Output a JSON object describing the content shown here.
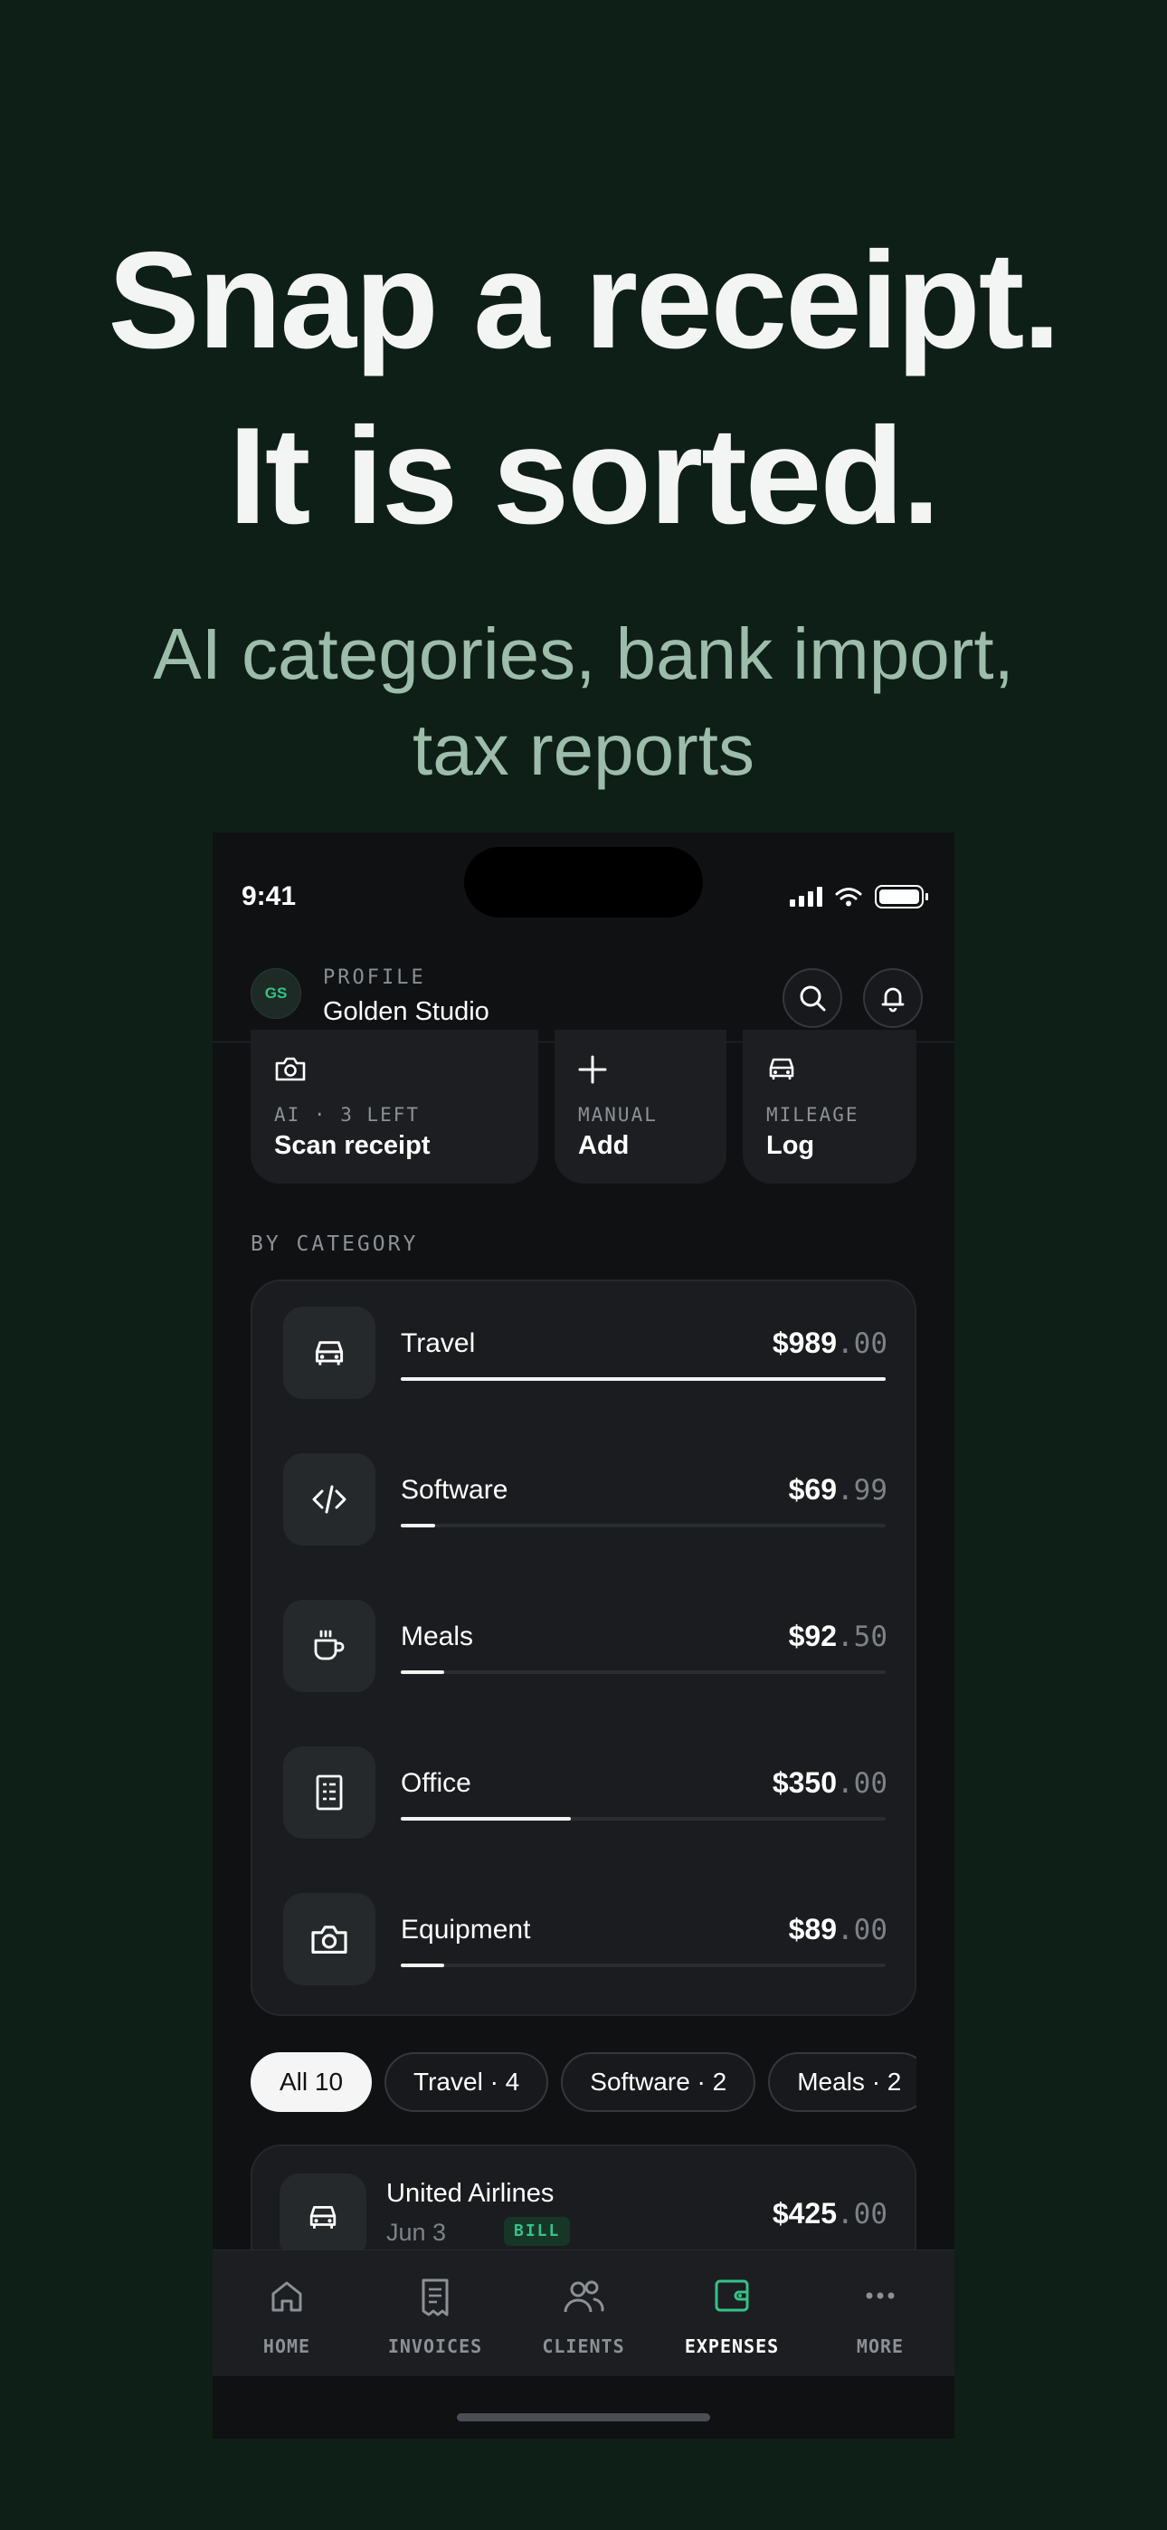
{
  "hero": {
    "title_line1": "Snap a receipt.",
    "title_line2": "It is sorted.",
    "subtitle_line1": "AI categories, bank import,",
    "subtitle_line2": "tax reports"
  },
  "status_bar": {
    "time": "9:41"
  },
  "profile": {
    "initials": "GS",
    "kicker": "PROFILE",
    "name": "Golden Studio"
  },
  "quick_actions": [
    {
      "kicker": "AI · 3 LEFT",
      "label": "Scan receipt",
      "icon": "camera-icon"
    },
    {
      "kicker": "MANUAL",
      "label": "Add",
      "icon": "plus-icon"
    },
    {
      "kicker": "MILEAGE",
      "label": "Log",
      "icon": "car-icon"
    }
  ],
  "by_category": {
    "label": "BY CATEGORY",
    "items": [
      {
        "name": "Travel",
        "dollars": "$989",
        "cents": ".00",
        "share": 1.0,
        "icon": "car-icon"
      },
      {
        "name": "Software",
        "dollars": "$69",
        "cents": ".99",
        "share": 0.07,
        "icon": "code-icon"
      },
      {
        "name": "Meals",
        "dollars": "$92",
        "cents": ".50",
        "share": 0.09,
        "icon": "coffee-cup-icon"
      },
      {
        "name": "Office",
        "dollars": "$350",
        "cents": ".00",
        "share": 0.35,
        "icon": "document-icon"
      },
      {
        "name": "Equipment",
        "dollars": "$89",
        "cents": ".00",
        "share": 0.09,
        "icon": "camera-icon"
      }
    ]
  },
  "filters": [
    "All 10",
    "Travel · 4",
    "Software · 2",
    "Meals · 2"
  ],
  "transactions": [
    {
      "name": "United Airlines",
      "date": "Jun 3",
      "badge": "BILL",
      "dollars": "$425",
      "cents": ".00",
      "icon": "car-icon"
    }
  ],
  "tabs": [
    {
      "label": "HOME",
      "icon": "home-icon"
    },
    {
      "label": "INVOICES",
      "icon": "receipt-icon"
    },
    {
      "label": "CLIENTS",
      "icon": "users-icon"
    },
    {
      "label": "EXPENSES",
      "icon": "wallet-icon",
      "active": true
    },
    {
      "label": "MORE",
      "icon": "more-icon"
    }
  ],
  "colors": {
    "background": "#0e1f17",
    "accent": "#34c388",
    "subtitle": "#9dbcab",
    "phone_bg": "#0f1113"
  }
}
